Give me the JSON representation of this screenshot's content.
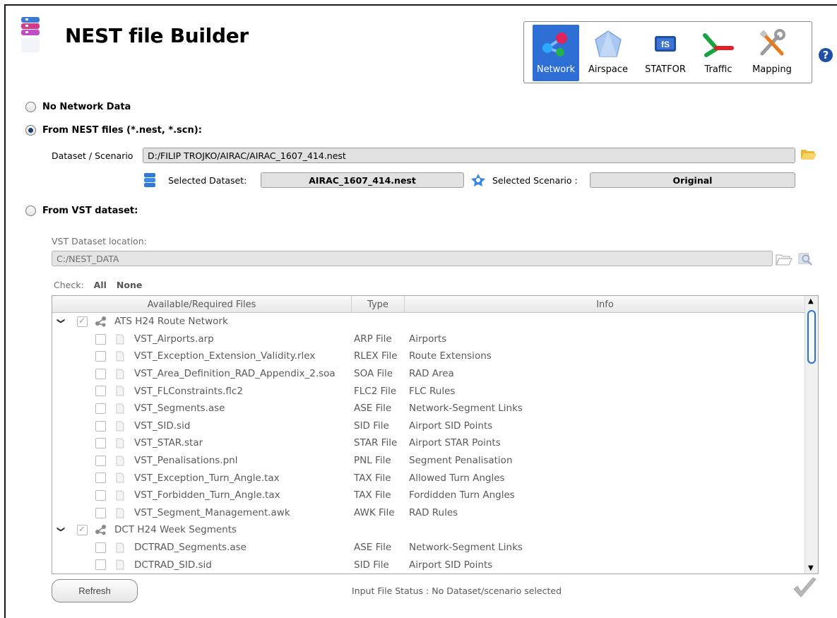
{
  "app": {
    "title": "NEST file Builder"
  },
  "modes": [
    {
      "label": "Network",
      "icon": "network-icon",
      "active": true
    },
    {
      "label": "Airspace",
      "icon": "airspace-icon",
      "active": false
    },
    {
      "label": "STATFOR",
      "icon": "statfor-icon",
      "active": false
    },
    {
      "label": "Traffic",
      "icon": "traffic-icon",
      "active": false
    },
    {
      "label": "Mapping",
      "icon": "mapping-icon",
      "active": false
    }
  ],
  "help_icon": "?",
  "options": {
    "no_network": "No Network Data",
    "from_nest": "From NEST files (*.nest, *.scn):",
    "from_vst": "From VST dataset:"
  },
  "nest": {
    "dataset_label": "Dataset / Scenario",
    "dataset_path": "D:/FILIP TROJKO/AIRAC/AIRAC_1607_414.nest",
    "selected_dataset_label": "Selected Dataset:",
    "selected_dataset": "AIRAC_1607_414.nest",
    "selected_scenario_label": "Selected Scenario :",
    "selected_scenario": "Original"
  },
  "vst": {
    "location_label": "VST Dataset location:",
    "location": "C:/NEST_DATA",
    "check_label": "Check:",
    "check_all": "All",
    "check_none": "None"
  },
  "table": {
    "headers": [
      "Available/Required Files",
      "Type",
      "Info"
    ],
    "rows": [
      {
        "group": true,
        "name": "ATS H24 Route Network",
        "type": "",
        "info": ""
      },
      {
        "group": false,
        "name": "VST_Airports.arp",
        "type": "ARP File",
        "info": "Airports"
      },
      {
        "group": false,
        "name": "VST_Exception_Extension_Validity.rlex",
        "type": "RLEX File",
        "info": "Route Extensions"
      },
      {
        "group": false,
        "name": "VST_Area_Definition_RAD_Appendix_2.soa",
        "type": "SOA File",
        "info": "RAD Area"
      },
      {
        "group": false,
        "name": "VST_FLConstraints.flc2",
        "type": "FLC2 File",
        "info": "FLC Rules"
      },
      {
        "group": false,
        "name": "VST_Segments.ase",
        "type": "ASE File",
        "info": "Network-Segment Links"
      },
      {
        "group": false,
        "name": "VST_SID.sid",
        "type": "SID File",
        "info": "Airport SID Points"
      },
      {
        "group": false,
        "name": "VST_STAR.star",
        "type": "STAR File",
        "info": "Airport STAR Points"
      },
      {
        "group": false,
        "name": "VST_Penalisations.pnl",
        "type": "PNL File",
        "info": "Segment Penalisation"
      },
      {
        "group": false,
        "name": "VST_Exception_Turn_Angle.tax",
        "type": "TAX File",
        "info": "Allowed Turn Angles"
      },
      {
        "group": false,
        "name": "VST_Forbidden_Turn_Angle.tax",
        "type": "TAX File",
        "info": "Fordidden Turn Angles"
      },
      {
        "group": false,
        "name": "VST_Segment_Management.awk",
        "type": "AWK File",
        "info": "RAD Rules"
      },
      {
        "group": true,
        "name": "DCT H24 Week Segments",
        "type": "",
        "info": ""
      },
      {
        "group": false,
        "name": "DCTRAD_Segments.ase",
        "type": "ASE File",
        "info": "Network-Segment Links"
      },
      {
        "group": false,
        "name": "DCTRAD_SID.sid",
        "type": "SID File",
        "info": "Airport SID Points"
      }
    ]
  },
  "footer": {
    "refresh_label": "Refresh",
    "status": "Input File Status : No Dataset/scenario selected"
  },
  "colors": {
    "accent": "#2e6fd6",
    "field_bg": "#e1e1e1"
  }
}
